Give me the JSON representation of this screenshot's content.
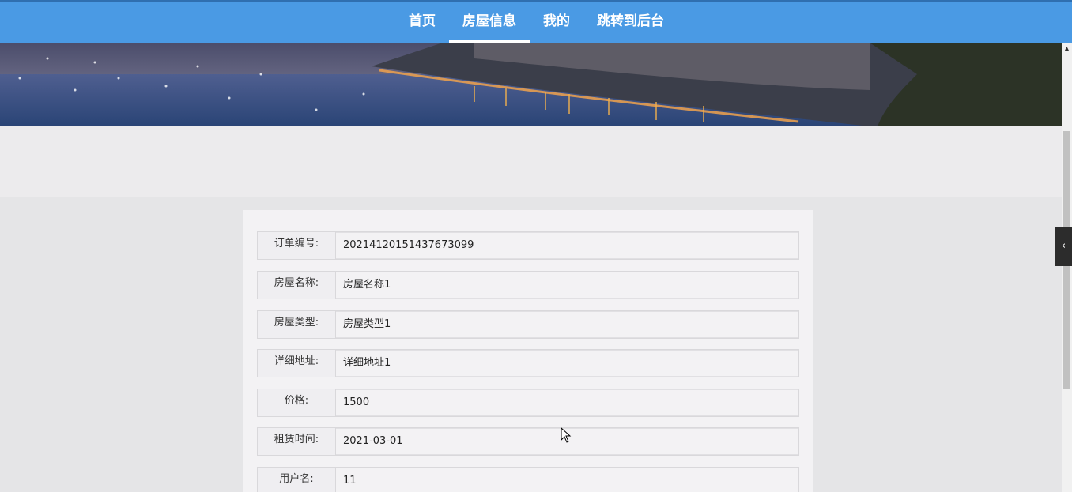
{
  "nav": {
    "items": [
      {
        "label": "首页",
        "active": false
      },
      {
        "label": "房屋信息",
        "active": true
      },
      {
        "label": "我的",
        "active": false
      },
      {
        "label": "跳转到后台",
        "active": false
      }
    ]
  },
  "form": {
    "rows": [
      {
        "label": "订单编号:",
        "value": "20214120151437673099"
      },
      {
        "label": "房屋名称:",
        "value": "房屋名称1"
      },
      {
        "label": "房屋类型:",
        "value": "房屋类型1"
      },
      {
        "label": "详细地址:",
        "value": "详细地址1"
      },
      {
        "label": "价格:",
        "value": "1500"
      },
      {
        "label": "租赁时间:",
        "value": "2021-03-01"
      },
      {
        "label": "用户名:",
        "value": "11"
      }
    ]
  },
  "side_tab": {
    "icon": "chevron-left-icon",
    "glyph": "‹"
  },
  "colors": {
    "nav_bg": "#4a9ae4",
    "page_bg": "#e5e5e7",
    "card_bg": "#f3f2f4"
  }
}
